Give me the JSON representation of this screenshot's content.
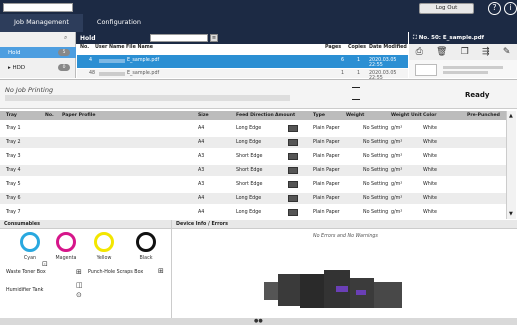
{
  "nav": {
    "tab1": "Job Management",
    "tab2": "Configuration",
    "logout": "Log Out"
  },
  "left": {
    "items": [
      {
        "label": "Hold",
        "count": "5"
      },
      {
        "label": "HDD",
        "count": "0"
      }
    ]
  },
  "hold": {
    "title": "Hold",
    "columns": [
      "No.",
      "User Name",
      "File Name",
      "Pages",
      "Copies",
      "Date Modified"
    ],
    "rows": [
      {
        "no": "4",
        "user": "",
        "file": "E_sample.pdf",
        "pages": "6",
        "copies": "1",
        "date": "2020.03.05 22:55"
      },
      {
        "no": "48",
        "user": "",
        "file": "E_sample.pdf",
        "pages": "1",
        "copies": "1",
        "date": "2020.03.05 22:55"
      }
    ]
  },
  "right": {
    "title": "No. 50: E_sample.pdf"
  },
  "status": {
    "title": "No Job Printing",
    "state": "Ready"
  },
  "trays": {
    "columns": [
      "Tray",
      "No.",
      "Paper Profile",
      "Size",
      "Feed Direction",
      "Amount",
      "Type",
      "Weight",
      "Weight Unit",
      "Color",
      "Pre-Punched"
    ],
    "rows": [
      {
        "tray": "Tray 1",
        "size": "A4",
        "feed": "Long Edge",
        "type": "Plain Paper",
        "weight": "No Setting",
        "unit": "g/m²",
        "color": "White"
      },
      {
        "tray": "Tray 2",
        "size": "A4",
        "feed": "Long Edge",
        "type": "Plain Paper",
        "weight": "No Setting",
        "unit": "g/m²",
        "color": "White"
      },
      {
        "tray": "Tray 3",
        "size": "A3",
        "feed": "Short Edge",
        "type": "Plain Paper",
        "weight": "No Setting",
        "unit": "g/m²",
        "color": "White"
      },
      {
        "tray": "Tray 4",
        "size": "A3",
        "feed": "Short Edge",
        "type": "Plain Paper",
        "weight": "No Setting",
        "unit": "g/m²",
        "color": "White"
      },
      {
        "tray": "Tray 5",
        "size": "A3",
        "feed": "Short Edge",
        "type": "Plain Paper",
        "weight": "No Setting",
        "unit": "g/m²",
        "color": "White"
      },
      {
        "tray": "Tray 6",
        "size": "A4",
        "feed": "Long Edge",
        "type": "Plain Paper",
        "weight": "No Setting",
        "unit": "g/m²",
        "color": "White"
      },
      {
        "tray": "Tray 7",
        "size": "A4",
        "feed": "Long Edge",
        "type": "Plain Paper",
        "weight": "No Setting",
        "unit": "g/m²",
        "color": "White"
      }
    ]
  },
  "consumables": {
    "title": "Consumables",
    "toners": [
      {
        "name": "Cyan",
        "color": "#29a8df"
      },
      {
        "name": "Magenta",
        "color": "#d6168a"
      },
      {
        "name": "Yellow",
        "color": "#f3e600"
      },
      {
        "name": "Black",
        "color": "#111111"
      }
    ],
    "waste": "Waste Toner Box",
    "punch": "Punch-Hole Scraps Box",
    "humid": "Humidifier Tank"
  },
  "device": {
    "title": "Device Info / Errors",
    "message": "No Errors and No Warnings"
  }
}
